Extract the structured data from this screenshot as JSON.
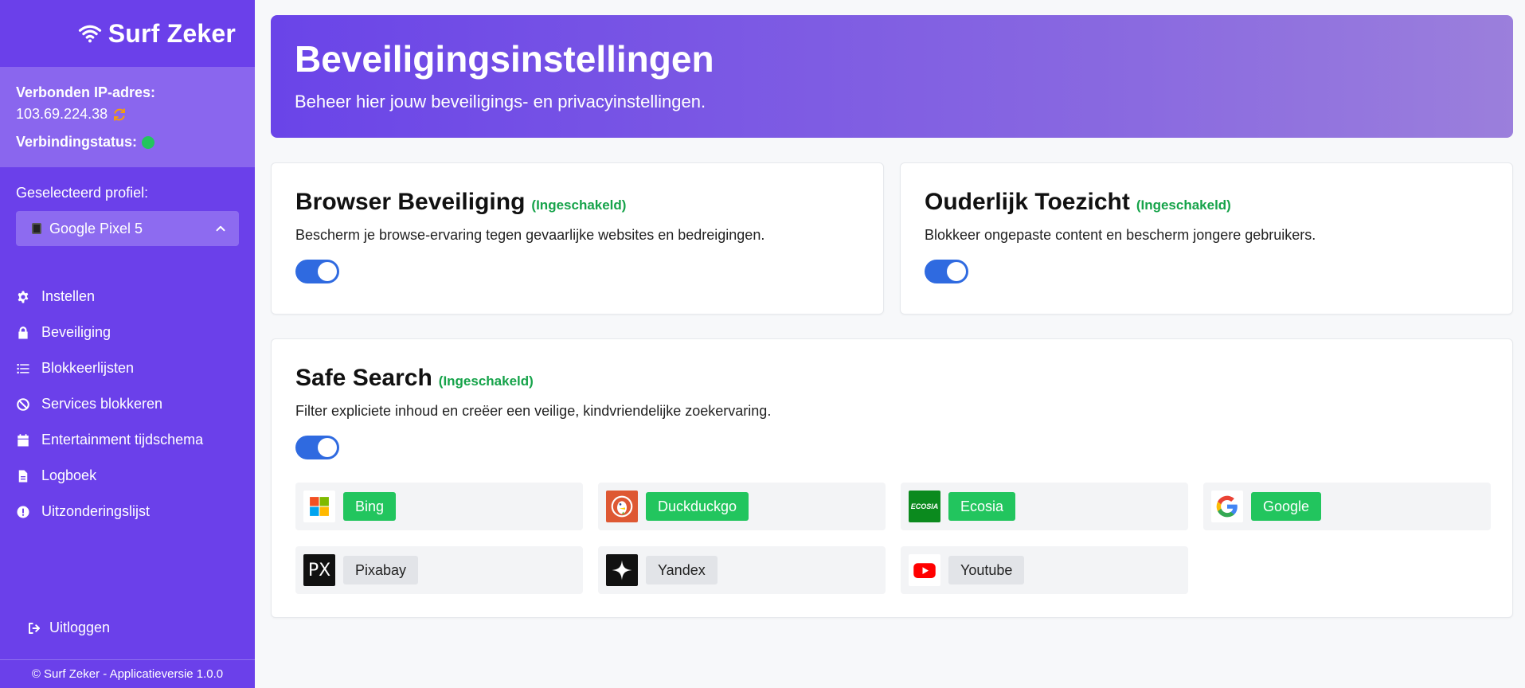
{
  "brand": {
    "name": "Surf Zeker"
  },
  "connection": {
    "ip_label": "Verbonden IP-adres:",
    "ip_value": "103.69.224.38",
    "status_label": "Verbindingstatus:"
  },
  "profile": {
    "label": "Geselecteerd profiel:",
    "selected": "Google Pixel 5"
  },
  "nav": [
    {
      "label": "Instellen",
      "icon": "gear-icon"
    },
    {
      "label": "Beveiliging",
      "icon": "lock-icon"
    },
    {
      "label": "Blokkeerlijsten",
      "icon": "list-icon"
    },
    {
      "label": "Services blokkeren",
      "icon": "ban-icon"
    },
    {
      "label": "Entertainment tijdschema",
      "icon": "calendar-icon"
    },
    {
      "label": "Logboek",
      "icon": "file-icon"
    },
    {
      "label": "Uitzonderingslijst",
      "icon": "exclamation-icon"
    }
  ],
  "logout": {
    "label": "Uitloggen"
  },
  "footer": {
    "text": "© Surf Zeker - Applicatieversie 1.0.0"
  },
  "hero": {
    "title": "Beveiligingsinstellingen",
    "subtitle": "Beheer hier jouw beveiligings- en privacyinstellingen."
  },
  "cards": {
    "browser": {
      "title": "Browser Beveiliging",
      "status": "(Ingeschakeld)",
      "description": "Bescherm je browse-ervaring tegen gevaarlijke websites en bedreigingen.",
      "enabled": true
    },
    "parental": {
      "title": "Ouderlijk Toezicht",
      "status": "(Ingeschakeld)",
      "description": "Blokkeer ongepaste content en bescherm jongere gebruikers.",
      "enabled": true
    },
    "safesearch": {
      "title": "Safe Search",
      "status": "(Ingeschakeld)",
      "description": "Filter expliciete inhoud en creëer een veilige, kindvriendelijke zoekervaring.",
      "enabled": true
    }
  },
  "engines": [
    {
      "name": "Bing",
      "active": true,
      "icon": "bing-icon"
    },
    {
      "name": "Duckduckgo",
      "active": true,
      "icon": "duckduckgo-icon"
    },
    {
      "name": "Ecosia",
      "active": true,
      "icon": "ecosia-icon",
      "logo_text": "ECOSIA"
    },
    {
      "name": "Google",
      "active": true,
      "icon": "google-icon"
    },
    {
      "name": "Pixabay",
      "active": false,
      "icon": "pixabay-icon",
      "logo_text": "PX"
    },
    {
      "name": "Yandex",
      "active": false,
      "icon": "yandex-icon"
    },
    {
      "name": "Youtube",
      "active": false,
      "icon": "youtube-icon"
    }
  ],
  "colors": {
    "sidebar": "#6b40ea",
    "enabled_green": "#16a34a",
    "toggle_blue": "#2f6ae0"
  }
}
